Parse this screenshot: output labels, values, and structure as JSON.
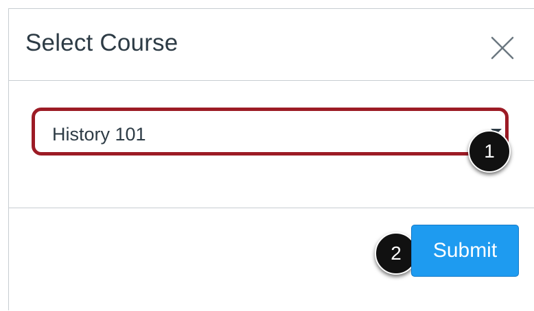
{
  "modal": {
    "title": "Select Course",
    "close_icon": "close-icon"
  },
  "course_select": {
    "selected_value": "History 101",
    "arrow_icon": "caret-down-icon"
  },
  "footer": {
    "submit_label": "Submit"
  },
  "callouts": [
    {
      "label": "1"
    },
    {
      "label": "2"
    }
  ],
  "colors": {
    "highlight_border": "#9c1b25",
    "submit_button": "#1e9bf0",
    "text": "#2d3b45",
    "callout": "#111111"
  }
}
